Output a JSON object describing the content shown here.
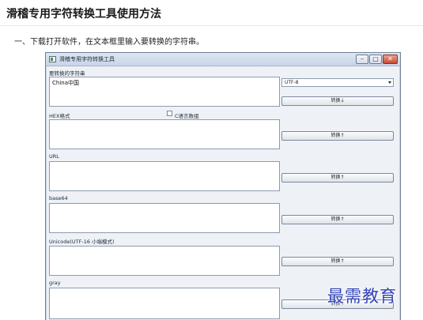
{
  "article": {
    "title": "滑稽专用字符转换工具使用方法",
    "step1": "一、下载打开软件，在文本框里输入要转换的字符串。"
  },
  "window": {
    "title": "滑稽专用字符转换工具",
    "controls": {
      "minimize": "–",
      "maximize": "□",
      "close": "✕"
    }
  },
  "tool": {
    "input_label": "要转换的字符串",
    "input_value": "China中国",
    "encoding_selected": "UTF-8",
    "convert_down_label": "转换↓",
    "hex_label": "HEX格式",
    "c_array_label": "C语言数组",
    "hex_convert_label": "转换↑",
    "url_label": "URL",
    "url_convert_label": "转换↑",
    "base64_label": "base64",
    "base64_convert_label": "转换↑",
    "unicode_label": "Unicode(UTF-16 小端模式)",
    "unicode_convert_label": "转换↑",
    "gray_label": "gray",
    "gray_convert_label": "转换↑"
  },
  "watermark": "最需教育"
}
